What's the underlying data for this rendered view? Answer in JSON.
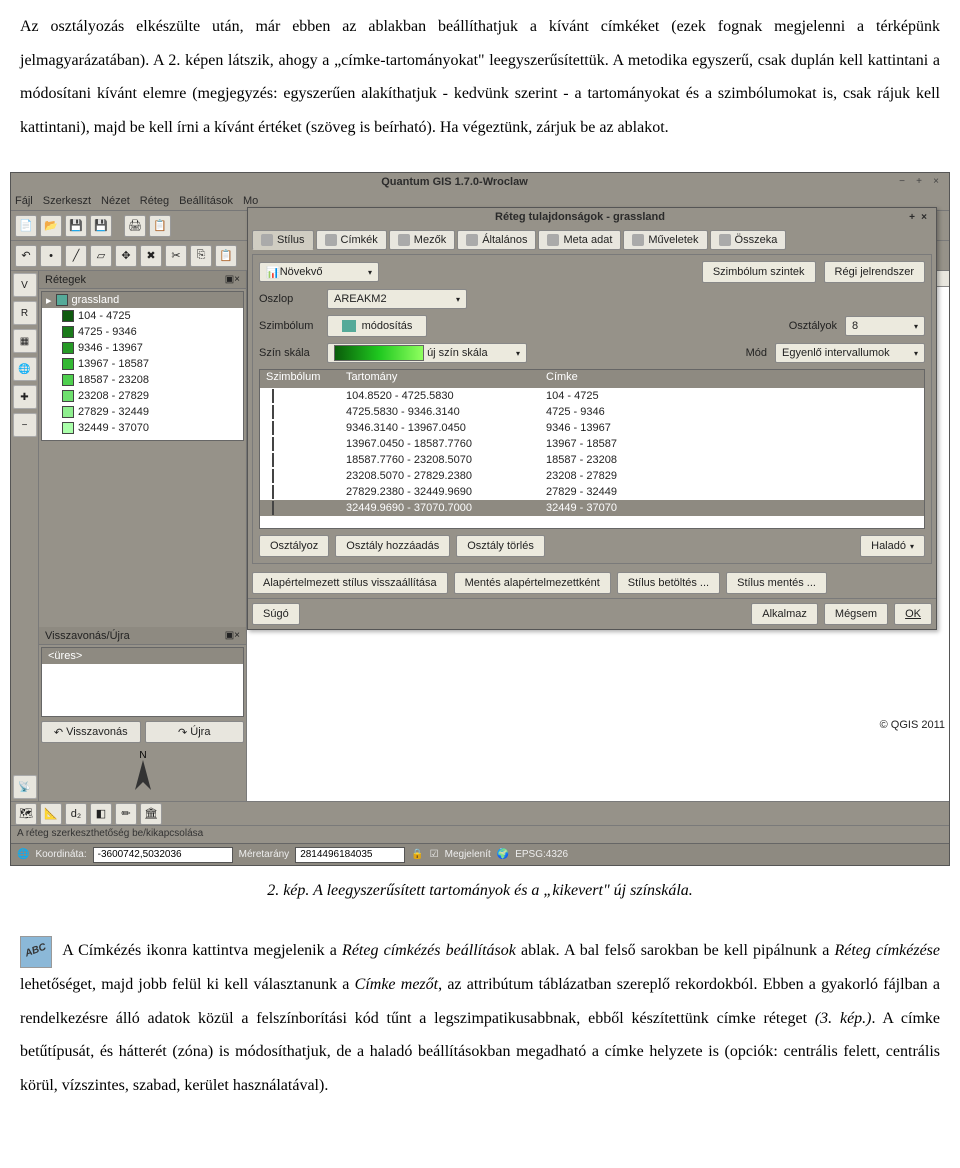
{
  "doc": {
    "p1": "Az osztályozás elkészülte után, már ebben az ablakban beállíthatjuk a kívánt címkéket (ezek fognak megjelenni a térképünk jelmagyarázatában). A 2. képen látszik, ahogy a „címke-tartományokat\" leegyszerűsítettük. A metodika egyszerű, csak duplán kell kattintani a módosítani kívánt elemre (megjegyzés: egyszerűen alakíthatjuk - kedvünk szerint - a tartományokat és a szimbólumokat is, csak rájuk kell kattintani), majd be kell írni a kívánt értéket (szöveg is beírható). Ha végeztünk, zárjuk be az ablakot.",
    "caption": "2. kép. A leegyszerűsített tartományok és a „kikevert\" új színskála.",
    "p2a": "A Címkézés ikonra kattintva megjelenik a ",
    "p2b": "Réteg címkézés beállítások",
    "p2c": " ablak. A bal felső sarokban be kell pipálnunk a ",
    "p2d": "Réteg címkézése",
    "p2e": " lehetőséget, majd jobb felül ki kell választanunk a ",
    "p2f": "Címke mezőt",
    "p2g": ", az attribútum táblázatban szereplő rekordokból. Ebben a gyakorló fájlban a rendelkezésre álló adatok közül a felszínborítási kód tűnt a legszimpatikusabbnak, ebből készítettünk címke réteget ",
    "p2h": "(3. kép.)",
    "p2i": ". A címke betűtípusát, és hátterét (zóna) is módosíthatjuk, de a haladó beállításokban megadható a címke helyzete is (opciók: centrális felett, centrális körül, vízszintes, szabad, kerület használatával)."
  },
  "app": {
    "title": "Quantum GIS 1.7.0-Wroclaw",
    "menus": [
      "Fájl",
      "Szerkeszt",
      "Nézet",
      "Réteg",
      "Beállítások",
      "Mo"
    ]
  },
  "dialog": {
    "title": "Réteg tulajdonságok - grassland",
    "tabs": [
      "Stílus",
      "Címkék",
      "Mezők",
      "Általános",
      "Meta adat",
      "Műveletek",
      "Összeka"
    ],
    "renderer": "Növekvő",
    "symbol_levels": "Szimbólum szintek",
    "old_renderer": "Régi jelrendszer",
    "column_label": "Oszlop",
    "column_value": "AREAKM2",
    "symbol_label": "Szimbólum",
    "symbol_value": "módosítás",
    "classes_label": "Osztályok",
    "classes_value": "8",
    "colorscale_label": "Szín skála",
    "colorscale_value": "új szín skála",
    "mode_label": "Mód",
    "mode_value": "Egyenlő intervallumok",
    "table": {
      "headers": [
        "Szimbólum",
        "Tartomány",
        "Címke"
      ],
      "rows": [
        {
          "color": "#0f5a0f",
          "range": "104.8520 - 4725.5830",
          "label": "104 - 4725",
          "sel": false
        },
        {
          "color": "#1a7a1a",
          "range": "4725.5830 - 9346.3140",
          "label": "4725 - 9346",
          "sel": false
        },
        {
          "color": "#269a26",
          "range": "9346.3140 - 13967.0450",
          "label": "9346 - 13967",
          "sel": false
        },
        {
          "color": "#33b833",
          "range": "13967.0450 - 18587.7760",
          "label": "13967 - 18587",
          "sel": false
        },
        {
          "color": "#4fd04f",
          "range": "18587.7760 - 23208.5070",
          "label": "18587 - 23208",
          "sel": false
        },
        {
          "color": "#6ee06e",
          "range": "23208.5070 - 27829.2380",
          "label": "23208 - 27829",
          "sel": false
        },
        {
          "color": "#8fef8f",
          "range": "27829.2380 - 32449.9690",
          "label": "27829 - 32449",
          "sel": false
        },
        {
          "color": "#aaffaa",
          "range": "32449.9690 - 37070.7000",
          "label": "32449 - 37070",
          "sel": true
        }
      ]
    },
    "classify": "Osztályoz",
    "add_class": "Osztály hozzáadás",
    "delete_class": "Osztály törlés",
    "advanced": "Haladó",
    "restore_default": "Alapértelmezett stílus visszaállítása",
    "save_default": "Mentés alapértelmezettként",
    "load_style": "Stílus betöltés ...",
    "save_style": "Stílus mentés ...",
    "help": "Súgó",
    "apply": "Alkalmaz",
    "cancel": "Mégsem",
    "ok": "OK"
  },
  "layers": {
    "title": "Rétegek",
    "name": "grassland",
    "items": [
      {
        "c": "#0f5a0f",
        "t": "104 - 4725"
      },
      {
        "c": "#1a7a1a",
        "t": "4725 - 9346"
      },
      {
        "c": "#269a26",
        "t": "9346 - 13967"
      },
      {
        "c": "#33b833",
        "t": "13967 - 18587"
      },
      {
        "c": "#4fd04f",
        "t": "18587 - 23208"
      },
      {
        "c": "#6ee06e",
        "t": "23208 - 27829"
      },
      {
        "c": "#8fef8f",
        "t": "27829 - 32449"
      },
      {
        "c": "#aaffaa",
        "t": "32449 - 37070"
      }
    ]
  },
  "undo": {
    "title": "Visszavonás/Újra",
    "empty": "<üres>",
    "undo_btn": "Visszavonás",
    "redo_btn": "Újra"
  },
  "status": {
    "msg": "A réteg szerkeszthetőség be/kikapcsolása",
    "coord_label": "Koordináta:",
    "coord_value": "-3600742,5032036",
    "scale_label": "Méretarány",
    "scale_value": "2814496184035",
    "render": "Megjelenít",
    "crs": "EPSG:4326"
  },
  "credit": "© QGIS 2011"
}
